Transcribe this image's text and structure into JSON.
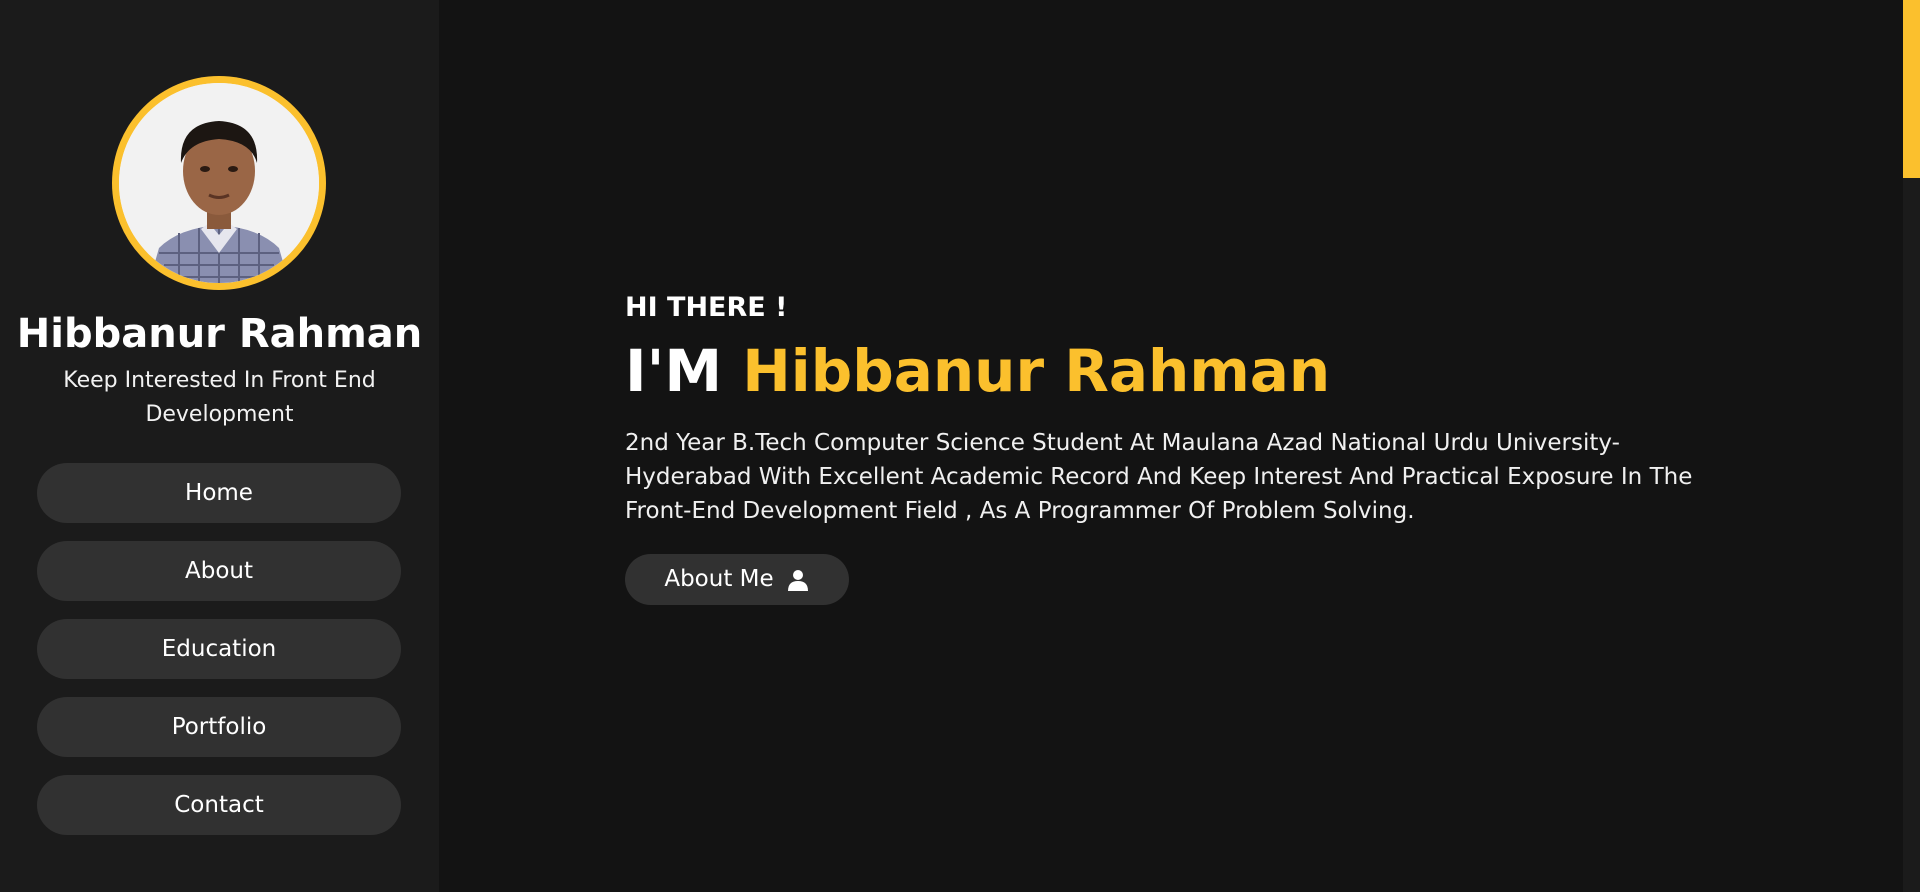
{
  "sidebar": {
    "avatar_alt": "Profile photo",
    "name": "Hibbanur Rahman",
    "tagline": "Keep Interested In Front End Development",
    "nav": [
      {
        "label": "Home"
      },
      {
        "label": "About"
      },
      {
        "label": "Education"
      },
      {
        "label": "Portfolio"
      },
      {
        "label": "Contact"
      }
    ]
  },
  "hero": {
    "greeting": "HI THERE !",
    "headline_prefix": "I'M",
    "headline_name": "Hibbanur Rahman",
    "intro": "2nd Year B.Tech Computer Science Student At Maulana Azad National Urdu University-Hyderabad With Excellent Academic Record And Keep Interest And Practical Exposure In The Front-End Development Field , As A Programmer Of Problem Solving.",
    "about_button": {
      "label": "About Me",
      "icon": "user-icon"
    }
  },
  "scrollbar": {
    "position_fraction": 0.0
  },
  "colors": {
    "accent": "#fbc02d",
    "background": "#131313",
    "sidebar": "#1b1b1b",
    "button": "#313131"
  }
}
